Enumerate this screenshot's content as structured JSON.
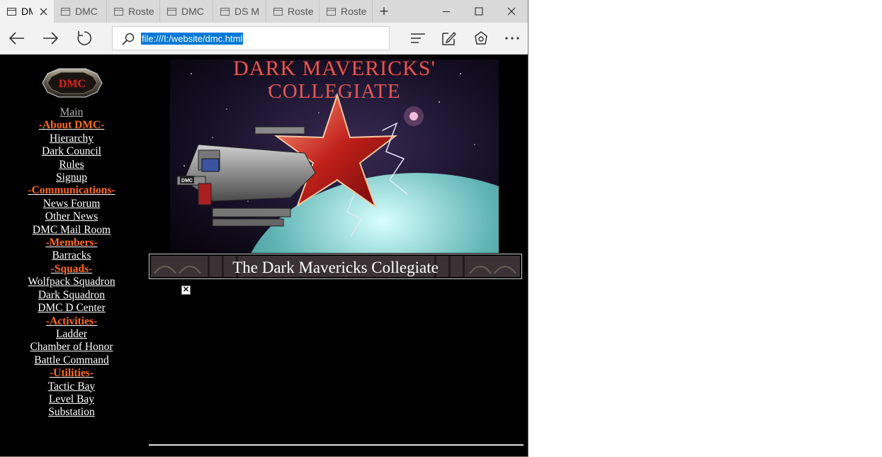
{
  "browser": {
    "tabs": [
      {
        "title": "DMC",
        "active": true
      },
      {
        "title": "DMC Wolfpack",
        "active": false
      },
      {
        "title": "Roster",
        "active": false
      },
      {
        "title": "DMC D",
        "active": false
      },
      {
        "title": "DS Members",
        "active": false
      },
      {
        "title": "Roster",
        "active": false
      },
      {
        "title": "Roster",
        "active": false
      }
    ],
    "new_tab_symbol": "+",
    "address": "file:///I:/website/dmc.html",
    "icons": [
      "back-icon",
      "forward-icon",
      "refresh-icon",
      "search-icon",
      "hub-icon",
      "web-note-icon",
      "share-icon",
      "more-icon",
      "minimize-icon",
      "maximize-icon",
      "close-icon"
    ],
    "accent": "#0078d7"
  },
  "site": {
    "logo_text": "DMC",
    "banner_line1": "DARK MAVERICKS'",
    "banner_line2": "COLLEGIATE",
    "banner_badge": "DMC",
    "page_title": "The Dark Mavericks Collegiate",
    "nav": {
      "main": "Main",
      "about_header": "-About DMC-",
      "hierarchy": "Hierarchy",
      "dark_council": "Dark Council",
      "rules": "Rules",
      "signup": "Signup",
      "communications_header": "-Communications-",
      "news_forum": "News Forum",
      "other_news": "Other News",
      "mail_room": "DMC Mail Room",
      "members_header": "-Members-",
      "barracks": "Barracks",
      "squads_header": "-Squads-",
      "wolfpack": "Wolfpack Squadron",
      "dark_squadron": "Dark Squadron",
      "d_center": "DMC D Center",
      "activities_header": "-Activities-",
      "ladder": "Ladder",
      "chamber": "Chamber of Honor",
      "battle_command": "Battle Command",
      "utilities_header": "-Utilities-",
      "tactic_bay": "Tactic Bay",
      "level_bay": "Level Bay",
      "substation": "Substation"
    },
    "colors": {
      "header": "#ff6a1a",
      "link": "#ffffff",
      "visited": "#b0b0b0",
      "background": "#000000"
    }
  }
}
